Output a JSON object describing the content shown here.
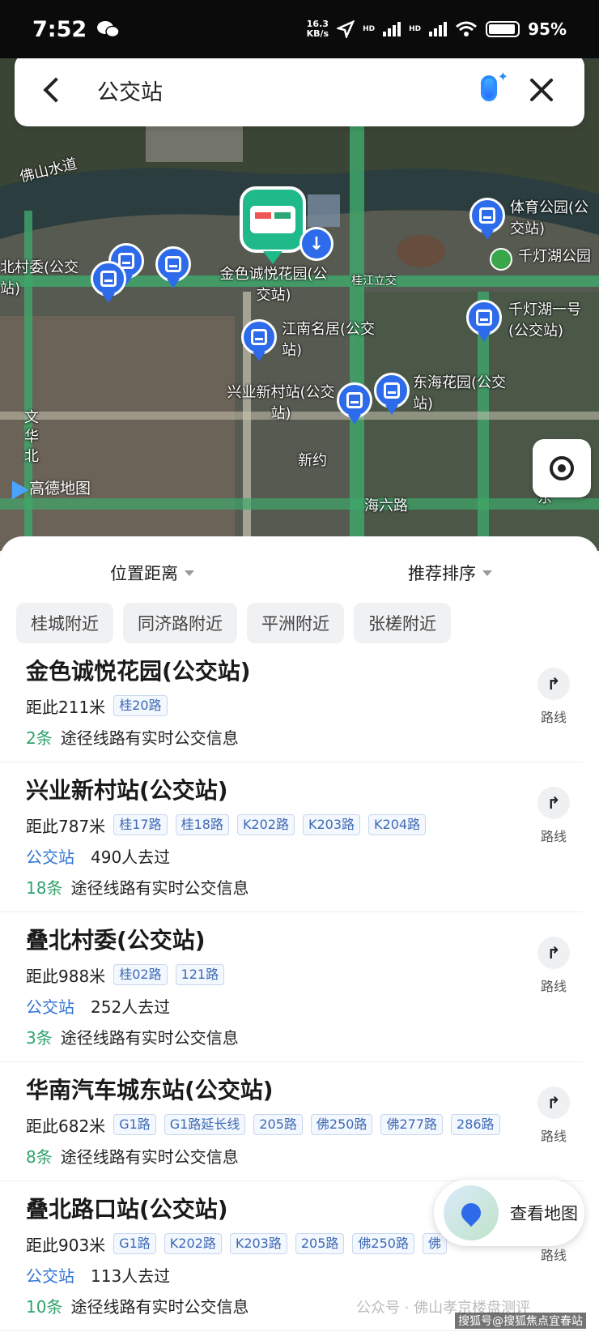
{
  "status_bar": {
    "time": "7:52",
    "net_speed_value": "16.3",
    "net_speed_unit": "KB/s",
    "hd1": "HD",
    "hd2": "HD",
    "battery": "95%",
    "battery_level": 0.95
  },
  "search": {
    "query": "公交站"
  },
  "map": {
    "labels": {
      "foshan_waterway": "佛山水道",
      "diebei_cunwei": "北村委(公交站)",
      "jinse": "金色诚悦花园(公交站)",
      "guijiang": "桂江立交",
      "tiyu": "体育公园(公交站)",
      "qiandenghu_park": "千灯湖公园",
      "qiandenghu_no1": "千灯湖一号(公交站)",
      "jiangnan": "江南名居(公交站)",
      "xingye": "兴业新村站(公交站)",
      "donghai": "东海花园(公交站)",
      "xinyue": "新约",
      "wenhua": "文华北",
      "haiba": "海六路",
      "dong": "东"
    },
    "logo": "高德地图"
  },
  "filters": {
    "distance": "位置距离",
    "sort": "推荐排序"
  },
  "chips": [
    "桂城附近",
    "同济路附近",
    "平洲附近",
    "张槎附近"
  ],
  "route_label": "路线",
  "results": [
    {
      "name": "金色诚悦花园(公交站)",
      "distance": "距此211米",
      "lines": [
        "桂20路"
      ],
      "visit_type": "",
      "visits": "",
      "realtime_count": "2条",
      "realtime_text": "途径线路有实时公交信息"
    },
    {
      "name": "兴业新村站(公交站)",
      "distance": "距此787米",
      "lines": [
        "桂17路",
        "桂18路",
        "K202路",
        "K203路",
        "K204路"
      ],
      "visit_type": "公交站",
      "visits": "490人去过",
      "realtime_count": "18条",
      "realtime_text": "途径线路有实时公交信息"
    },
    {
      "name": "叠北村委(公交站)",
      "distance": "距此988米",
      "lines": [
        "桂02路",
        "121路"
      ],
      "visit_type": "公交站",
      "visits": "252人去过",
      "realtime_count": "3条",
      "realtime_text": "途径线路有实时公交信息"
    },
    {
      "name": "华南汽车城东站(公交站)",
      "distance": "距此682米",
      "lines": [
        "G1路",
        "G1路延长线",
        "205路",
        "佛250路",
        "佛277路",
        "286路"
      ],
      "visit_type": "",
      "visits": "",
      "realtime_count": "8条",
      "realtime_text": "途径线路有实时公交信息"
    },
    {
      "name": "叠北路口站(公交站)",
      "distance": "距此903米",
      "lines": [
        "G1路",
        "K202路",
        "K203路",
        "205路",
        "佛250路",
        "佛"
      ],
      "visit_type": "公交站",
      "visits": "113人去过",
      "realtime_count": "10条",
      "realtime_text": "途径线路有实时公交信息"
    }
  ],
  "view_map": "查看地图",
  "watermark": "公众号 · 佛山孝京楼盘测评",
  "watermark2": "搜狐号@搜狐焦点宜春站",
  "colors": {
    "accent_blue": "#2d6bea",
    "realtime_green": "#2fa36b",
    "tag_blue": "#3d6ab5"
  }
}
